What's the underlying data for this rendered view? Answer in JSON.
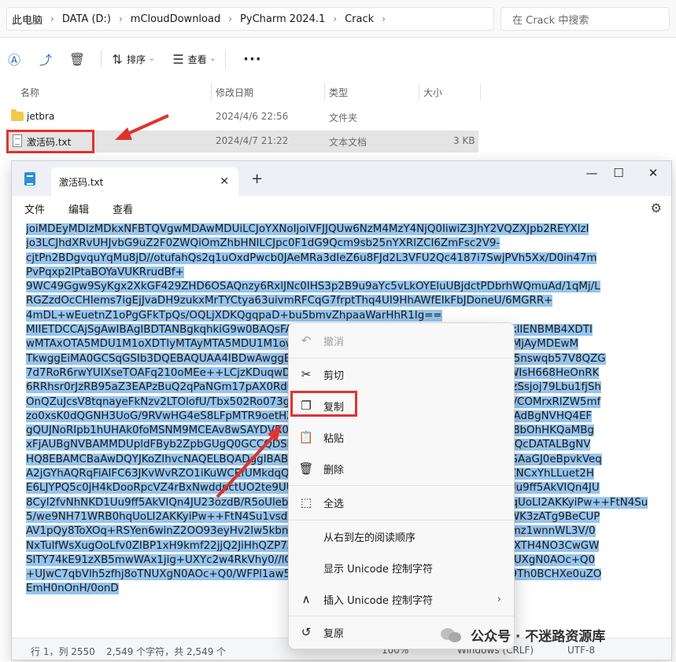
{
  "explorer": {
    "breadcrumbs": [
      "此电脑",
      "DATA (D:)",
      "mCloudDownload",
      "PyCharm 2024.1",
      "Crack"
    ],
    "search_placeholder": "在 Crack 中搜索",
    "toolbar": {
      "sort_label": "排序",
      "view_label": "查看",
      "more_label": "···"
    },
    "columns": {
      "name": "名称",
      "date": "修改日期",
      "type": "类型",
      "size": "大小"
    },
    "files": [
      {
        "name": "jetbra",
        "date": "2024/4/6 22:56",
        "type": "文件夹",
        "size": ""
      },
      {
        "name": "激活码.txt",
        "date": "2024/4/7 21:22",
        "type": "文本文档",
        "size": "3 KB"
      }
    ]
  },
  "notepad": {
    "tab_title": "激活码.txt",
    "menu": [
      "文件",
      "编辑",
      "查看"
    ],
    "text_lines": [
      "joiMDEyMDIzMDkxNFBTQVgwMDAwMDUiLCJoYXNoIjoiVFJJQUw6NzM4MzY4NjQ0IiwiZ3JhY2VQZXJpb2REYXlzI",
      "jo3LCJhdXRvUHJvbG9uZ2F0ZWQiOmZhbHNlLCJpc0F1dG9Qcm9sb25nYXRlZCI6ZmFsc2V9-",
      "cjtPn2BDgvquYqMu8jD//otufahQs2q1uOxdPwcb0JAeMRa3dIeZ6u8FJd2L3VFU2Qc4187i7SwjPVh5Xx/D0in47m",
      "PvPqxp2lPtaBOYaVUKRrudBf+",
      "9WC49Ggw9SyKgx2XkGF429ZHD6OSAQnzy6RxlJNc0IHS3p2B9u9aYc5vLkOYEluUBjdctPDbrhWQmuAd/1qMj/L",
      "RGZzdOcCHIems7igEjJvaDH9zukxMrTYCtya63uivmRFCqG7frptThq4UI9HhAWfEIkFbJDoneU/6MGRR+",
      "4mDL+wEuetnZ1oPgGFkTpQs/OQLjXDKQgqpaD+bu5bmvZhpaaWarHhR1Ig==",
      "MIIETDCCAjSgAwIBAgIBDTANBgkqhkiG9w0BAQsFADAYMRYwFAYDVQQDDA1KZXRQcm9maWxlIENBMB4XDTI",
      "wMTAxOTA5MDU1M1oXDTIyMTAyMTA5MDU1M1owHzEdMBsGA1UEAwwUcHJvZDJ5LWZyb20tMjAyMDEwM",
      "TkwggEiMA0GCSqGSIb3DQEBAQUAA4IBDwAwggEKAoIBAQDCP4uk4SlVdA5nuA3DQAL2euKQ5nswqb57V8QZG",
      "7d7RoR6rwYUIXseTOAFq210oMEe++LCjzKDuqwDfsyhgDNTgZBPAaC4vUU2oy2XR8gq8nBixWIsH668HeOnRK",
      "6RRhsr0rJzRB95aZ3EAPzBuQ2qPaNGm17pAX0Rd6MPRgjp75IWwI9eA6aMEdPQEVN7uyOtM5zSsjoj79Lbu1fjSh",
      "OnQZuJcsV8tqnayeFkNzv2LTOlofU/Tbx502Ro073gGjoeRzNvrynAP03pL486P3KCAyiNPhDs2z8/COMrxRlZW5mf",
      "zo0xsK0dQGNH3UoG/9RVwHG4eS8LFpMTR9oetHZBAgMBAAGjgZkwgZYwCQYDVR0TBAIwADAdBgNVHQ4EF",
      "gQUJNoRIpb1hUHAk0foMSNM9MCEAv8wSAYDVR0jBEEwP4AUo562SGdCEjZBvW3gubSgUouX8bOhHKQaMBg",
      "xFjAUBgNVBAMMDUpldFByb2ZpbGUgQ0GCCQDSbLGDsoN54TATBgNVHSUEDDAKBggrBgEFBQcDATALBgNV",
      "HQ8EBAMCBaAwDQYJKoZIhvcNAQELBQADggIBABqRoNGxAQct9dQUFK8xqhiZaYPd30TlmCmSAaGJ0eBpvkVeq",
      "A2jGYhAQRqFiAlFC63JKvWvRZO1iKuWCEfUMkdqQ9VQPXziE/BlsOIgrL6RlJfuFcEZ8TK3syIfIGQZNCxYhLLuet2H",
      "E6LJYPQ5c0jH4kDooRpcVZ4rBxNwddpctUO2te9UU5/FjhioZQsPvd92qOTsV+8Cyl2fvNhNKD1Uu9ff5AkVIQn4JU",
      "8Cyl2fvNhNKD1Uu9ff5AkVIQn4JU23ozdB/R5oUlebwaTE6WZNBs+TA/qPj+5/we9NH71WRB0hqUoLI2AKKyiPw++FtN4Su",
      "5/we9NH71WRB0hqUoLI2AKKyiPw++FtN4Su1vsdDlrAzDj9ILjpjJKA1ImuVcG329/WTYIKysZ1CWK3zATg9BeCUP",
      "AV1pQy8ToXOq+RSYen6winZ2OO93eyHv2Iw5kbn1dqfBw1BuTE29V2FJKicJSu8iEOpfoafwJISXmz1wnnWL3V/0",
      "NxTulfWsXugOoLfv0ZIBP1xH9kmf22jjQ2JiHhQZP7ZDsreRrOeIQ/c4yR8IQvMLfC0WKQqrHu5ZzXTH4NO3CwGW",
      "SlTY74kE91zXB5mwWAx1jig+UXYc2w4RkVhy0//lOmVya/PEepuuTTI4+UJwC7qbVlh5zfhj8oTNUXgN0AOc+Q0",
      "+UJwC7qbVlh5zfhj8oTNUXgN0AOc+Q0/WFPl1aw5VV/VrO8FCoB15lFVlpKaQ1Yh+DVU8ke+rt9Th0BCHXe0uZO",
      "EmH0nOnH/0onD"
    ],
    "status": {
      "position": "行 1，列 2550",
      "chars": "2,549 个字符，共 2,549 个",
      "zoom": "100%",
      "line_ending": "Windows (CRLF)",
      "encoding": "UTF-8"
    }
  },
  "context_menu": {
    "items": [
      {
        "label": "撤消",
        "icon": "undo-icon",
        "disabled": true
      },
      {
        "label": "剪切",
        "icon": "cut-icon",
        "disabled": false
      },
      {
        "label": "复制",
        "icon": "copy-icon",
        "disabled": false
      },
      {
        "label": "粘贴",
        "icon": "paste-icon",
        "disabled": false
      },
      {
        "label": "删除",
        "icon": "delete-icon",
        "disabled": false
      },
      {
        "label": "全选",
        "icon": "select-all-icon",
        "disabled": false
      },
      {
        "label": "从右到左的阅读顺序",
        "icon": "",
        "disabled": false
      },
      {
        "label": "显示 Unicode 控制字符",
        "icon": "",
        "disabled": false
      },
      {
        "label": "插入 Unicode 控制字符",
        "icon": "insert-icon",
        "disabled": false
      },
      {
        "label": "复原",
        "icon": "restore-icon",
        "disabled": false
      }
    ]
  },
  "watermark_text": "不迷路资源库",
  "wechat_badge": "公众号 · 不迷路资源库",
  "colors": {
    "selection": "#95c4ee",
    "annotation_red": "#e0332e",
    "accent": "#2a6ebb"
  }
}
